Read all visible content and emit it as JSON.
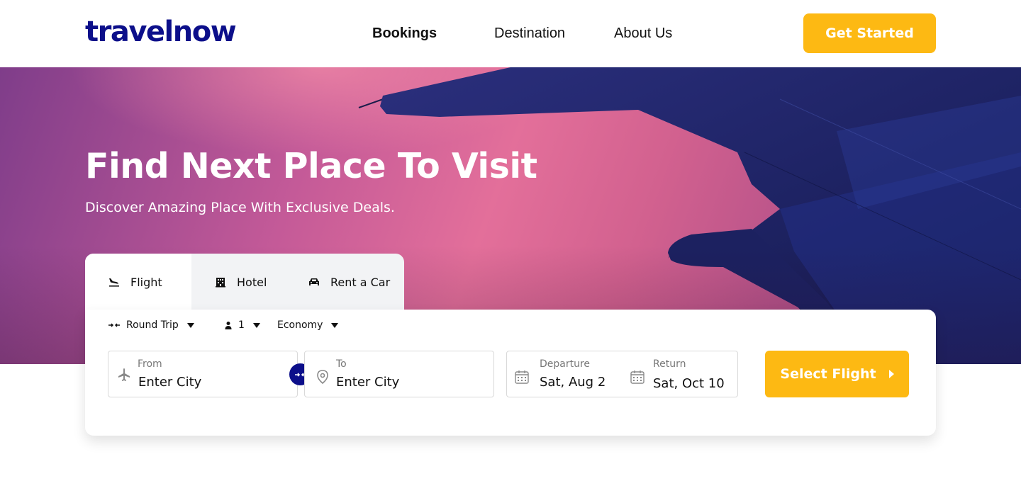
{
  "header": {
    "logo": "travelnow",
    "nav": [
      {
        "label": "Bookings",
        "active": true
      },
      {
        "label": "Destination",
        "active": false
      },
      {
        "label": "About Us",
        "active": false
      }
    ],
    "cta_label": "Get Started"
  },
  "hero": {
    "title": "Find Next Place To Visit",
    "subtitle": "Discover Amazing Place With Exclusive Deals."
  },
  "tabs": [
    {
      "label": "Flight",
      "icon": "plane-landing-icon",
      "active": true
    },
    {
      "label": "Hotel",
      "icon": "building-icon",
      "active": false
    },
    {
      "label": "Rent a Car",
      "icon": "car-icon",
      "active": false
    }
  ],
  "search": {
    "trip_type": "Round Trip",
    "passengers": "1",
    "cabin_class": "Economy",
    "from": {
      "label": "From",
      "value": "Enter City"
    },
    "to": {
      "label": "To",
      "value": "Enter City"
    },
    "departure": {
      "label": "Departure",
      "value": "Sat, Aug 2"
    },
    "return": {
      "label": "Return",
      "value": "Sat, Oct 10"
    },
    "submit_label": "Select Flight"
  },
  "colors": {
    "brand": "#0c0f8a",
    "accent": "#fdb913"
  }
}
